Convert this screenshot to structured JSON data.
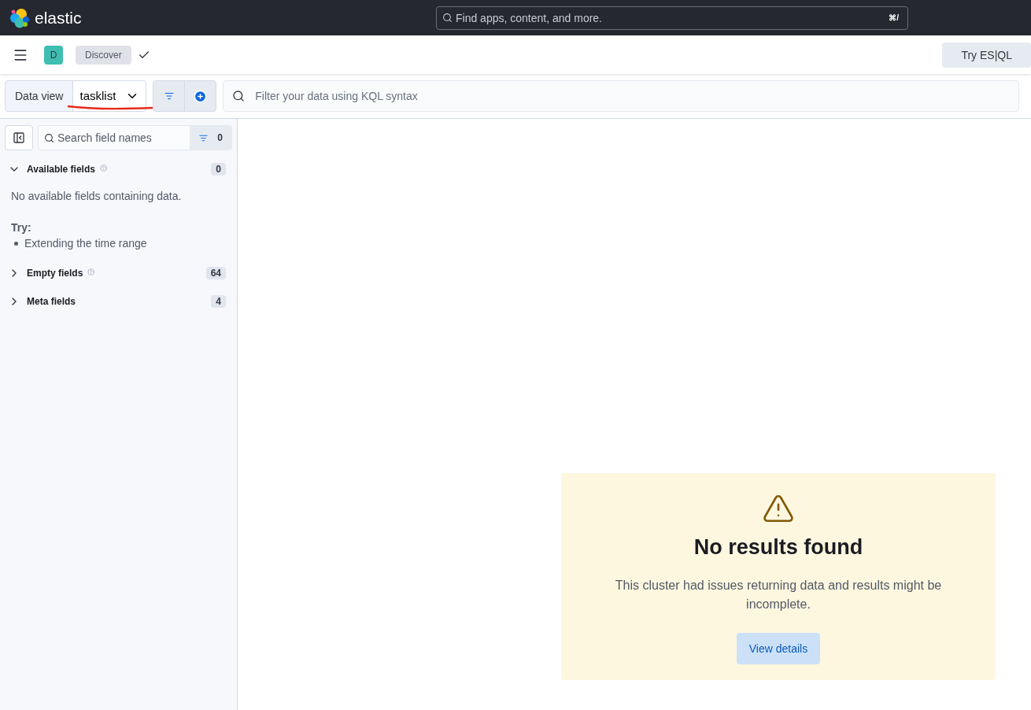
{
  "header": {
    "brand": "elastic",
    "search": {
      "placeholder": "Find apps, content, and more."
    },
    "shortcut": "⌘/"
  },
  "breadcrumbs": {
    "space_initial": "D",
    "app": "Discover"
  },
  "try_button": "Try ES|QL",
  "query_bar": {
    "data_view_label": "Data view",
    "data_view": "tasklist",
    "filter": {
      "placeholder": "Filter your data using KQL syntax"
    }
  },
  "sidebar": {
    "search": {
      "placeholder": "Search field names"
    },
    "filter_count": "0",
    "groups": [
      {
        "label": "Available fields",
        "count": "0",
        "expanded": true,
        "info": true,
        "empty_message": "No available fields containing data.",
        "try_label": "Try:",
        "suggestions": [
          "Extending the time range"
        ]
      },
      {
        "label": "Empty fields",
        "count": "64",
        "expanded": false,
        "info": true
      },
      {
        "label": "Meta fields",
        "count": "4",
        "expanded": false,
        "info": false
      }
    ]
  },
  "callout": {
    "title": "No results found",
    "message": "This cluster had issues returning data and results might be incomplete.",
    "button": "View details"
  }
}
